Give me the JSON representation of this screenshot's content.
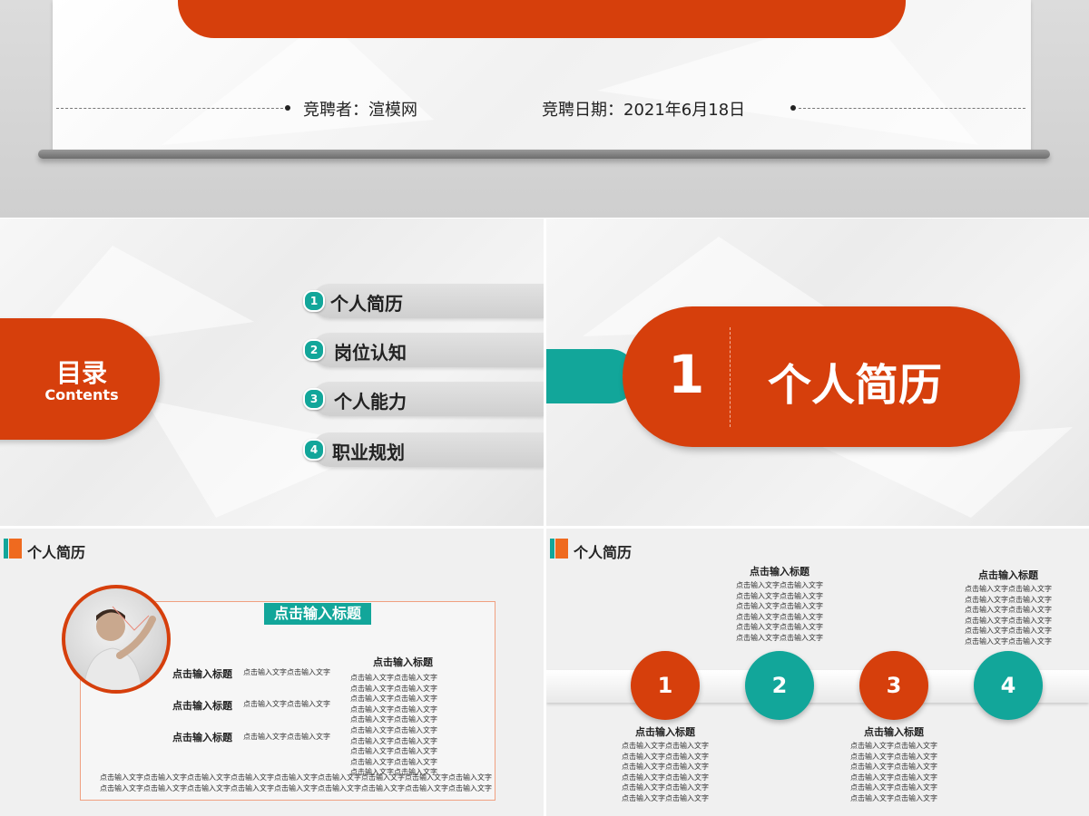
{
  "cover": {
    "candidate": "竞聘者：渲模网",
    "date": "竞聘日期：2021年6月18日"
  },
  "contents": {
    "title": "目录",
    "subtitle": "Contents",
    "items": [
      {
        "num": "1",
        "label": "个人简历"
      },
      {
        "num": "2",
        "label": "岗位认知"
      },
      {
        "num": "3",
        "label": "个人能力"
      },
      {
        "num": "4",
        "label": "职业规划"
      }
    ]
  },
  "section": {
    "number": "1",
    "title": "个人简历"
  },
  "profile_slide": {
    "header": "个人简历",
    "main_title": "点击输入标题",
    "rows": [
      {
        "title": "点击输入标题",
        "text": "点击输入文字点击输入文字"
      },
      {
        "title": "点击输入标题",
        "text": "点击输入文字点击输入文字"
      },
      {
        "title": "点击输入标题",
        "text": "点击输入文字点击输入文字"
      }
    ],
    "right_title": "点击输入标题",
    "right_text": "点击输入文字点击输入文字\n点击输入文字点击输入文字\n点击输入文字点击输入文字\n点击输入文字点击输入文字\n点击输入文字点击输入文字\n点击输入文字点击输入文字\n点击输入文字点击输入文字\n点击输入文字点击输入文字\n点击输入文字点击输入文字\n点击输入文字点击输入文字",
    "footer_text": "点击输入文字点击输入文字点击输入文字点击输入文字点击输入文字点击输入文字点击输入文字点击输入文字点击输入文字\n点击输入文字点击输入文字点击输入文字点击输入文字点击输入文字点击输入文字点击输入文字点击输入文字点击输入文字"
  },
  "timeline_slide": {
    "header": "个人简历",
    "nodes": [
      {
        "num": "1",
        "color": "#d63f0c",
        "title": "点击输入标题",
        "text": "点击输入文字点击输入文字\n点击输入文字点击输入文字\n点击输入文字点击输入文字\n点击输入文字点击输入文字\n点击输入文字点击输入文字\n点击输入文字点击输入文字"
      },
      {
        "num": "2",
        "color": "#12a69a",
        "title": "点击输入标题",
        "text": "点击输入文字点击输入文字\n点击输入文字点击输入文字\n点击输入文字点击输入文字\n点击输入文字点击输入文字\n点击输入文字点击输入文字\n点击输入文字点击输入文字"
      },
      {
        "num": "3",
        "color": "#d63f0c",
        "title": "点击输入标题",
        "text": "点击输入文字点击输入文字\n点击输入文字点击输入文字\n点击输入文字点击输入文字\n点击输入文字点击输入文字\n点击输入文字点击输入文字\n点击输入文字点击输入文字"
      },
      {
        "num": "4",
        "color": "#12a69a",
        "title": "点击输入标题",
        "text": "点击输入文字点击输入文字\n点击输入文字点击输入文字\n点击输入文字点击输入文字\n点击输入文字点击输入文字\n点击输入文字点击输入文字\n点击输入文字点击输入文字"
      }
    ]
  }
}
